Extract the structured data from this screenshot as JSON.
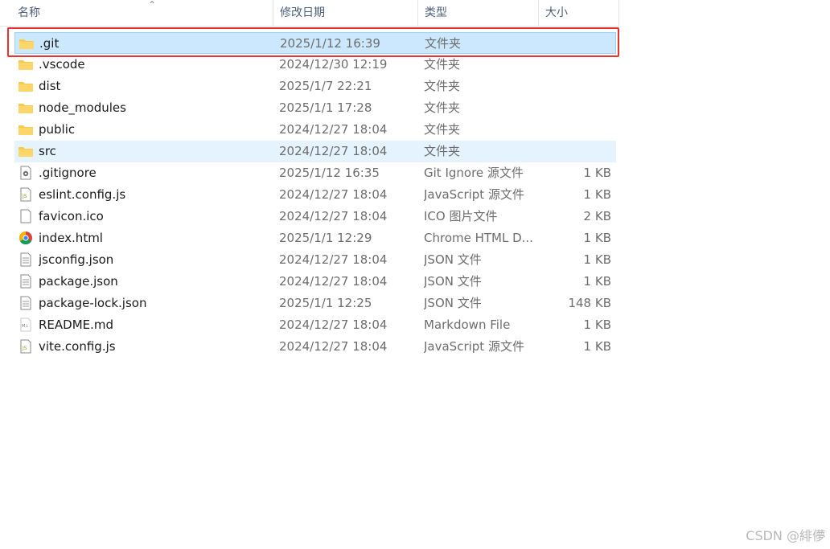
{
  "columns": {
    "name": "名称",
    "modified": "修改日期",
    "type": "类型",
    "size": "大小"
  },
  "files": [
    {
      "name": ".git",
      "modified": "2025/1/12 16:39",
      "type": "文件夹",
      "size": "",
      "icon": "folder-icon",
      "state": "selected"
    },
    {
      "name": ".vscode",
      "modified": "2024/12/30 12:19",
      "type": "文件夹",
      "size": "",
      "icon": "folder-icon",
      "state": ""
    },
    {
      "name": "dist",
      "modified": "2025/1/7 22:21",
      "type": "文件夹",
      "size": "",
      "icon": "folder-icon",
      "state": ""
    },
    {
      "name": "node_modules",
      "modified": "2025/1/1 17:28",
      "type": "文件夹",
      "size": "",
      "icon": "folder-icon",
      "state": ""
    },
    {
      "name": "public",
      "modified": "2024/12/27 18:04",
      "type": "文件夹",
      "size": "",
      "icon": "folder-icon",
      "state": ""
    },
    {
      "name": "src",
      "modified": "2024/12/27 18:04",
      "type": "文件夹",
      "size": "",
      "icon": "folder-icon",
      "state": "hover"
    },
    {
      "name": ".gitignore",
      "modified": "2025/1/12 16:35",
      "type": "Git Ignore 源文件",
      "size": "1 KB",
      "icon": "gear-file-icon",
      "state": ""
    },
    {
      "name": "eslint.config.js",
      "modified": "2024/12/27 18:04",
      "type": "JavaScript 源文件",
      "size": "1 KB",
      "icon": "js-file-icon",
      "state": ""
    },
    {
      "name": "favicon.ico",
      "modified": "2024/12/27 18:04",
      "type": "ICO 图片文件",
      "size": "2 KB",
      "icon": "blank-file-icon",
      "state": ""
    },
    {
      "name": "index.html",
      "modified": "2025/1/1 12:29",
      "type": "Chrome HTML D...",
      "size": "1 KB",
      "icon": "chrome-icon",
      "state": ""
    },
    {
      "name": "jsconfig.json",
      "modified": "2024/12/27 18:04",
      "type": "JSON 文件",
      "size": "1 KB",
      "icon": "text-file-icon",
      "state": ""
    },
    {
      "name": "package.json",
      "modified": "2024/12/27 18:04",
      "type": "JSON 文件",
      "size": "1 KB",
      "icon": "text-file-icon",
      "state": ""
    },
    {
      "name": "package-lock.json",
      "modified": "2025/1/1 12:25",
      "type": "JSON 文件",
      "size": "148 KB",
      "icon": "text-file-icon",
      "state": ""
    },
    {
      "name": "README.md",
      "modified": "2024/12/27 18:04",
      "type": "Markdown File",
      "size": "1 KB",
      "icon": "markdown-file-icon",
      "state": ""
    },
    {
      "name": "vite.config.js",
      "modified": "2024/12/27 18:04",
      "type": "JavaScript 源文件",
      "size": "1 KB",
      "icon": "js-file-icon",
      "state": ""
    }
  ],
  "colors": {
    "highlight": "#e8322f",
    "selected_bg": "#cce8ff",
    "hover_bg": "#e5f3ff",
    "folder": "#f8c94a"
  },
  "watermark": "CSDN @緋儚"
}
